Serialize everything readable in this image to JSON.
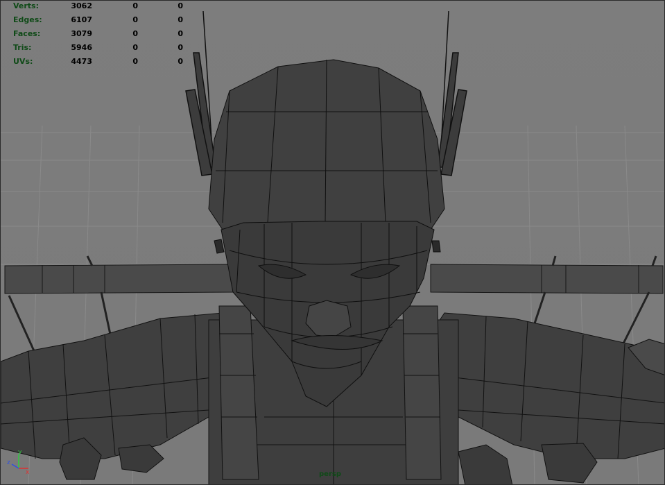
{
  "hud": {
    "rows": [
      {
        "label": "Verts:",
        "values": [
          "3062",
          "0",
          "0"
        ]
      },
      {
        "label": "Edges:",
        "values": [
          "6107",
          "0",
          "0"
        ]
      },
      {
        "label": "Faces:",
        "values": [
          "3079",
          "0",
          "0"
        ]
      },
      {
        "label": "Tris:",
        "values": [
          "5946",
          "0",
          "0"
        ]
      },
      {
        "label": "UVs:",
        "values": [
          "4473",
          "0",
          "0"
        ]
      }
    ]
  },
  "camera": {
    "name": "persp"
  },
  "axis": {
    "x": "x",
    "y": "y",
    "z": "z"
  },
  "colors": {
    "hud_label": "#0f4a17",
    "hud_value": "#000000",
    "grid_background": "#7d7d7d",
    "mesh_fill": "#3e3e3e",
    "wire": "#111111"
  }
}
